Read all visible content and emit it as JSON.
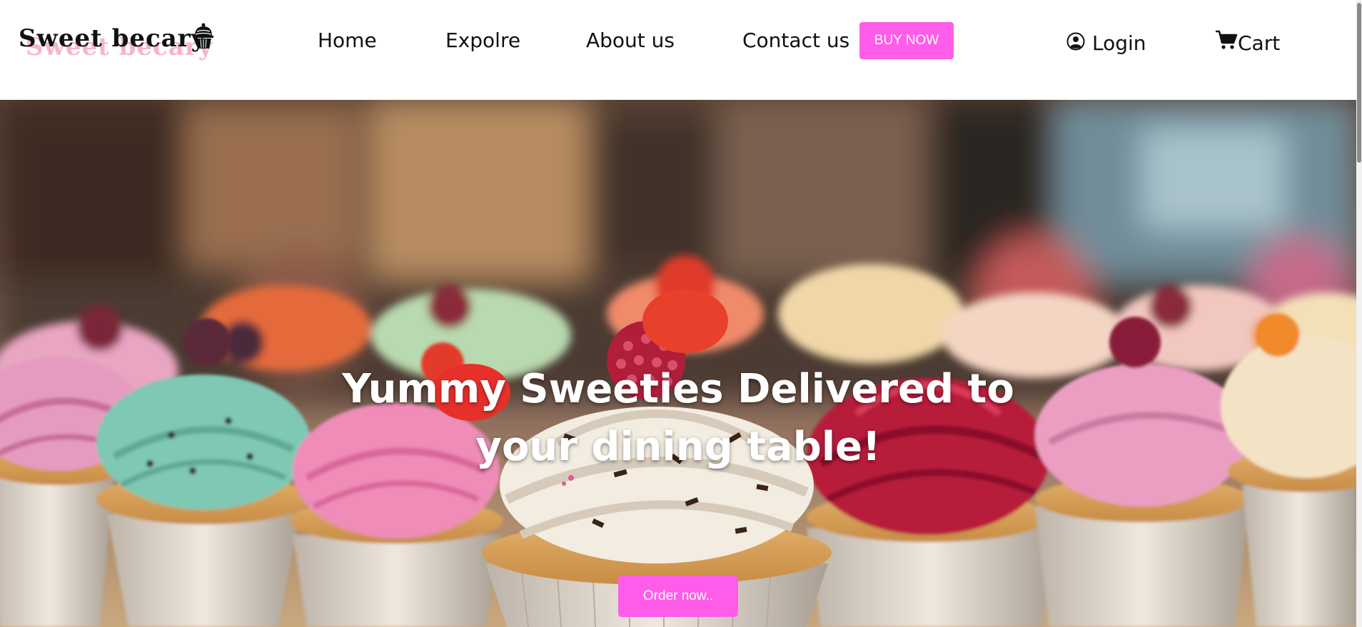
{
  "brand": {
    "name": "Sweet becary",
    "icon": "cupcake-icon"
  },
  "nav": {
    "items": [
      {
        "label": "Home"
      },
      {
        "label": "Expolre"
      },
      {
        "label": "About us"
      },
      {
        "label": "Contact us"
      }
    ],
    "buy_label": "BUY NOW",
    "login_label": "Login",
    "login_icon": "user-circle-icon",
    "cart_label": "Cart",
    "cart_icon": "cart-icon"
  },
  "hero": {
    "heading_line1": "Yummy Sweeties Delivered to",
    "heading_line2": "your dining table!",
    "cta_label": "Order now..",
    "background": "cupcakes-photo"
  },
  "colors": {
    "accent": "#ff5de9",
    "logo_shadow": "#f7a6c8",
    "text": "#111111"
  }
}
